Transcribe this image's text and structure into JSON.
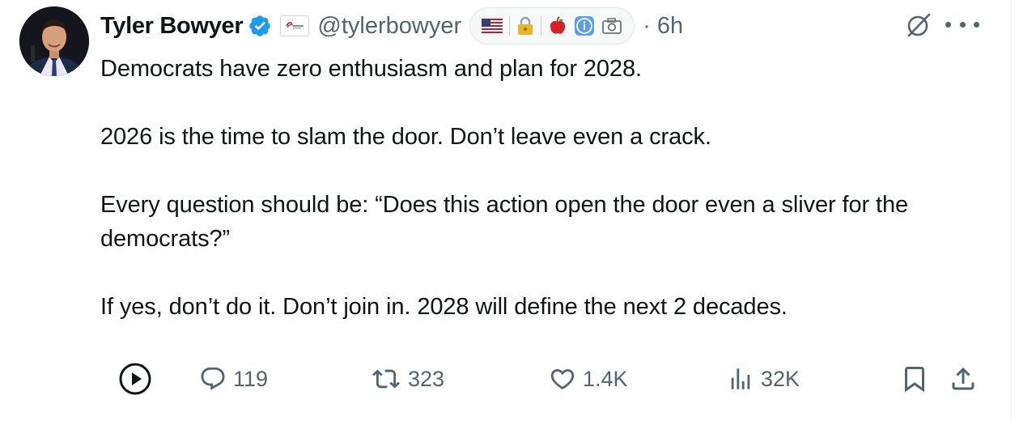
{
  "author": {
    "name": "Tyler Bowyer",
    "handle": "@tylerbowyer",
    "verified_icon": "verified-badge-icon",
    "affiliation_icon": "organization-logo-icon"
  },
  "bio_emojis": [
    "flag-us-icon",
    "lock-icon",
    "apple-icon",
    "info-icon",
    "camera-icon"
  ],
  "timestamp": "· 6h",
  "tweet": {
    "paragraphs": [
      "Democrats have zero enthusiasm and plan for 2028.",
      "2026 is the time to slam the door. Don’t leave even a crack.",
      "Every question should be: “Does this action open the door even a sliver for the democrats?”",
      "If yes, don’t do it. Don’t join in. 2028 will define the next 2 decades."
    ]
  },
  "metrics": {
    "replies": "119",
    "reposts": "323",
    "likes": "1.4K",
    "views": "32K"
  },
  "colors": {
    "text": "#0f1419",
    "secondary": "#536471",
    "verified": "#1d9bf0",
    "border": "#cfd9de"
  }
}
